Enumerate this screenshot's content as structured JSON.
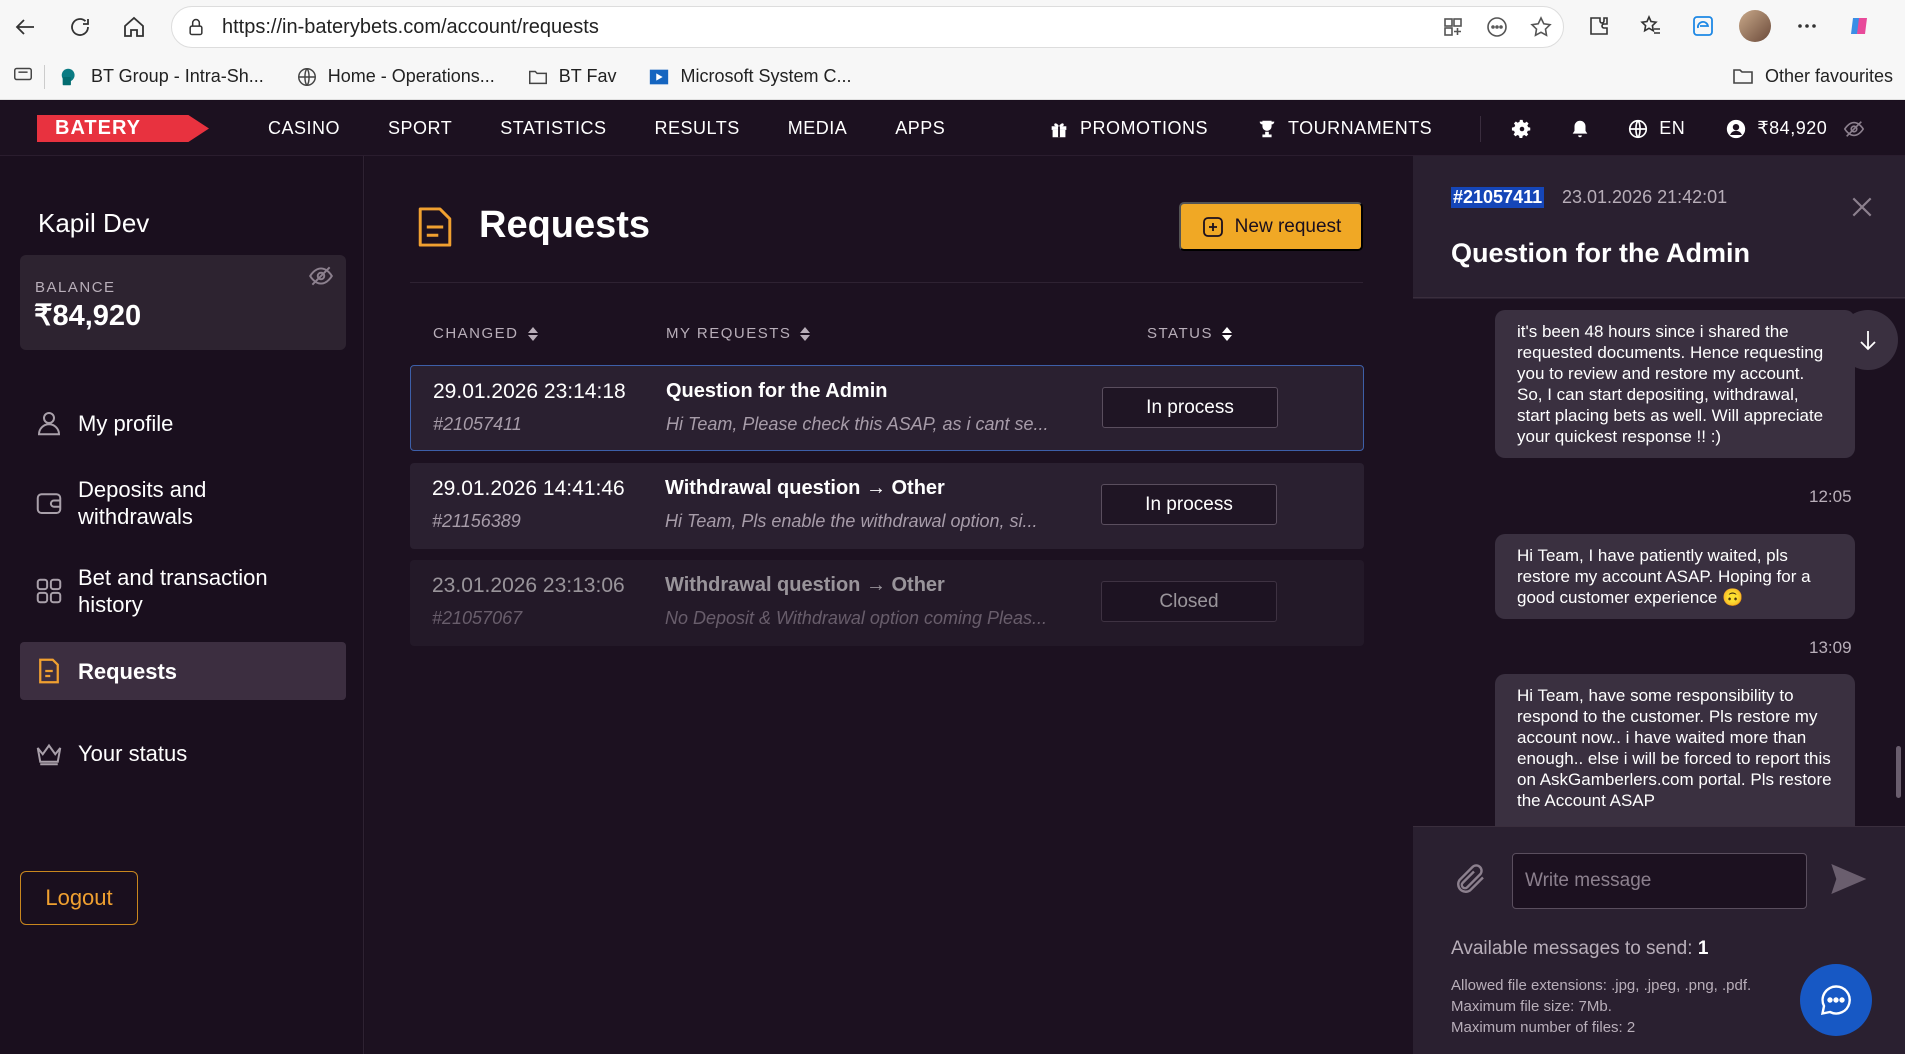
{
  "browser": {
    "url": "https://in-baterybets.com/account/requests",
    "bookmarks": [
      {
        "label": "BT Group - Intra-Sh..."
      },
      {
        "label": "Home - Operations..."
      },
      {
        "label": "BT Fav"
      },
      {
        "label": "Microsoft System C..."
      }
    ],
    "other_favourites": "Other favourites"
  },
  "header": {
    "logo": "BATERY",
    "nav": [
      "CASINO",
      "SPORT",
      "STATISTICS",
      "RESULTS",
      "MEDIA",
      "APPS"
    ],
    "promotions": "PROMOTIONS",
    "tournaments": "TOURNAMENTS",
    "language": "EN",
    "balance": "₹84,920"
  },
  "sidebar": {
    "username": "Kapil Dev",
    "balance_label": "BALANCE",
    "balance_value": "₹84,920",
    "items": [
      {
        "label": "My profile"
      },
      {
        "label": "Deposits and withdrawals"
      },
      {
        "label": "Bet and transaction history"
      },
      {
        "label": "Requests"
      },
      {
        "label": "Your status"
      }
    ],
    "logout": "Logout"
  },
  "main": {
    "title": "Requests",
    "new_request": "New request",
    "columns": {
      "changed": "CHANGED",
      "my_requests": "MY REQUESTS",
      "status": "STATUS"
    },
    "rows": [
      {
        "date": "29.01.2026 23:14:18",
        "id": "#21057411",
        "title": "Question for the Admin",
        "snippet": "Hi Team, Please check this ASAP, as i cant se...",
        "status": "In process"
      },
      {
        "date": "29.01.2026 14:41:46",
        "id": "#21156389",
        "title": "Withdrawal question → Other",
        "snippet": "Hi Team, Pls enable the withdrawal option, si...",
        "status": "In process"
      },
      {
        "date": "23.01.2026 23:13:06",
        "id": "#21057067",
        "title": "Withdrawal question → Other",
        "snippet": "No Deposit & Withdrawal option coming Pleas...",
        "status": "Closed"
      }
    ]
  },
  "chat": {
    "id": "#21057411",
    "date": "23.01.2026 21:42:01",
    "title": "Question for the Admin",
    "messages": [
      {
        "text": "it's been 48 hours since i shared the requested documents. Hence requesting you to review and restore my account. So, I can start depositing, withdrawal, start placing bets as well. Will appreciate your quickest response !! :)",
        "time": "12:05"
      },
      {
        "text": "Hi Team, I have patiently waited, pls restore my account ASAP. Hoping for a good customer experience 🙃",
        "time": "13:09"
      },
      {
        "text": "Hi Team, have some responsibility to respond to the customer. Pls restore my account now.. i have waited more than enough.. else i will be forced to report this on AskGamberlers.com portal. Pls restore the Account ASAP",
        "time": ""
      }
    ],
    "input_placeholder": "Write message",
    "available_label": "Available messages to send:",
    "available_count": "1",
    "file_info": [
      "Allowed file extensions: .jpg, .jpeg, .png, .pdf.",
      "Maximum file size: 7Mb.",
      "Maximum number of files: 2"
    ]
  },
  "colors": {
    "accent": "#f0a825",
    "brand": "#e8323f",
    "selection": "#1546b8",
    "support": "#1758c4"
  }
}
